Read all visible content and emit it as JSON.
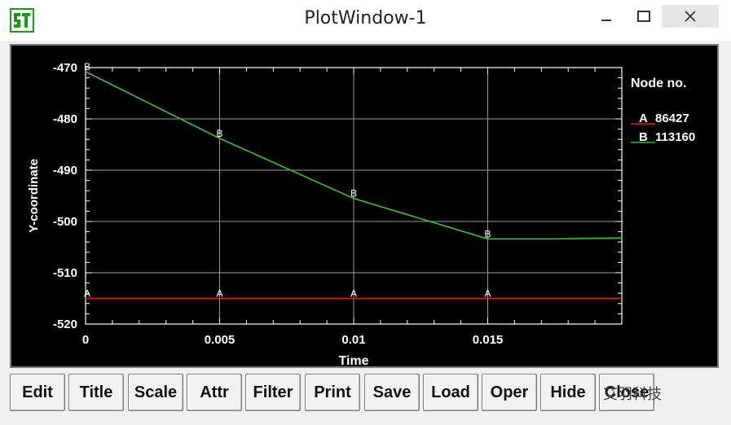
{
  "window": {
    "title": "PlotWindow-1",
    "icons": {
      "app": "app-logo-icon",
      "minimize": "minimize-icon",
      "maximize": "maximize-icon",
      "close": "close-icon"
    }
  },
  "buttons": [
    "Edit",
    "Title",
    "Scale",
    "Attr",
    "Filter",
    "Print",
    "Save",
    "Load",
    "Oper",
    "Hide",
    "Close"
  ],
  "watermark": "艾羽科技",
  "colors": {
    "plot_bg": "#000000",
    "axis": "#ffffff",
    "grid": "#9a9a9a",
    "series_a": "#e02020",
    "series_b": "#39c03a"
  },
  "chart_data": {
    "type": "line",
    "xlabel": "Time",
    "ylabel": "Y-coordinate",
    "xlim": [
      0,
      0.02
    ],
    "ylim": [
      -520,
      -470
    ],
    "x_ticks": [
      0,
      0.005,
      0.01,
      0.015
    ],
    "x_tick_labels": [
      "0",
      "0.005",
      "0.01",
      "0.015"
    ],
    "y_ticks": [
      -470,
      -480,
      -490,
      -500,
      -510,
      -520
    ],
    "y_tick_labels": [
      "-470",
      "-480",
      "-490",
      "-500",
      "-510",
      "-520"
    ],
    "grid": true,
    "legend": {
      "title": "Node no.",
      "position": "right"
    },
    "series": [
      {
        "name": "86427",
        "marker": "A",
        "color": "#e02020",
        "x": [
          0,
          0.005,
          0.01,
          0.015,
          0.02
        ],
        "y": [
          -515,
          -515,
          -515,
          -515,
          -515
        ]
      },
      {
        "name": "113160",
        "marker": "B",
        "color": "#39c03a",
        "x": [
          0,
          0.005,
          0.01,
          0.015,
          0.0175,
          0.02
        ],
        "y": [
          -470.8,
          -483.8,
          -495.5,
          -503.4,
          -503.4,
          -503.2
        ]
      }
    ],
    "marker_x": [
      0,
      0.005,
      0.01,
      0.015
    ]
  }
}
